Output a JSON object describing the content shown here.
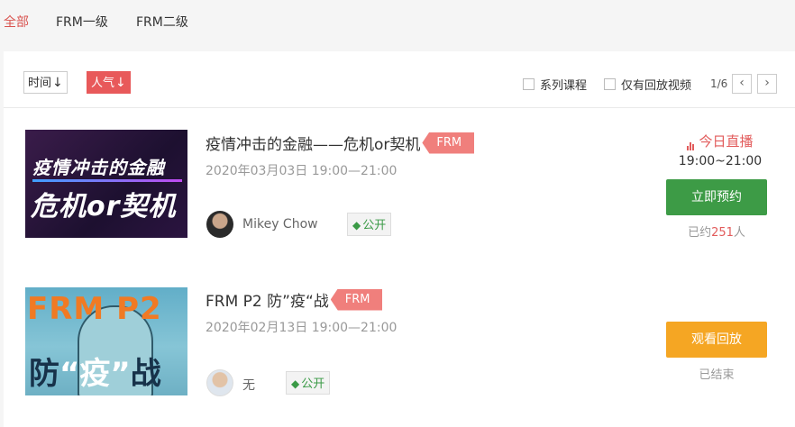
{
  "tabs": [
    {
      "label": "全部",
      "active": true
    },
    {
      "label": "FRM一级",
      "active": false
    },
    {
      "label": "FRM二级",
      "active": false
    }
  ],
  "sort": {
    "time_label": "时间",
    "popularity_label": "人气",
    "arrow": "↓"
  },
  "filters": {
    "series_label": "系列课程",
    "replay_only_label": "仅有回放视频"
  },
  "pager": {
    "text": "1/6",
    "prev": "‹",
    "next": "›"
  },
  "courses": [
    {
      "thumb_line1": "疫情冲击的金融",
      "thumb_line2": "危机or契机",
      "title": "疫情冲击的金融——危机or契机",
      "tag": "FRM",
      "date": "2020年03月03日 19:00—21:00",
      "teacher": "Mikey Chow",
      "access": "公开",
      "status_label": "今日直播",
      "status_time": "19:00~21:00",
      "button": "立即预约",
      "booked_prefix": "已约",
      "booked_count": "251",
      "booked_suffix": "人"
    },
    {
      "thumb_line1": "FRM P2",
      "thumb_line2a": "防",
      "thumb_line2b": "“疫”",
      "thumb_line2c": "战",
      "title": "FRM P2 防”疫“战",
      "tag": "FRM",
      "date": "2020年02月13日 19:00—21:00",
      "teacher": "无",
      "access": "公开",
      "button": "观看回放",
      "status_after": "已结束"
    }
  ],
  "colors": {
    "accent_red": "#e8595a",
    "tag_red": "#f07f7c",
    "green": "#3d9b46",
    "orange": "#f5a623"
  }
}
